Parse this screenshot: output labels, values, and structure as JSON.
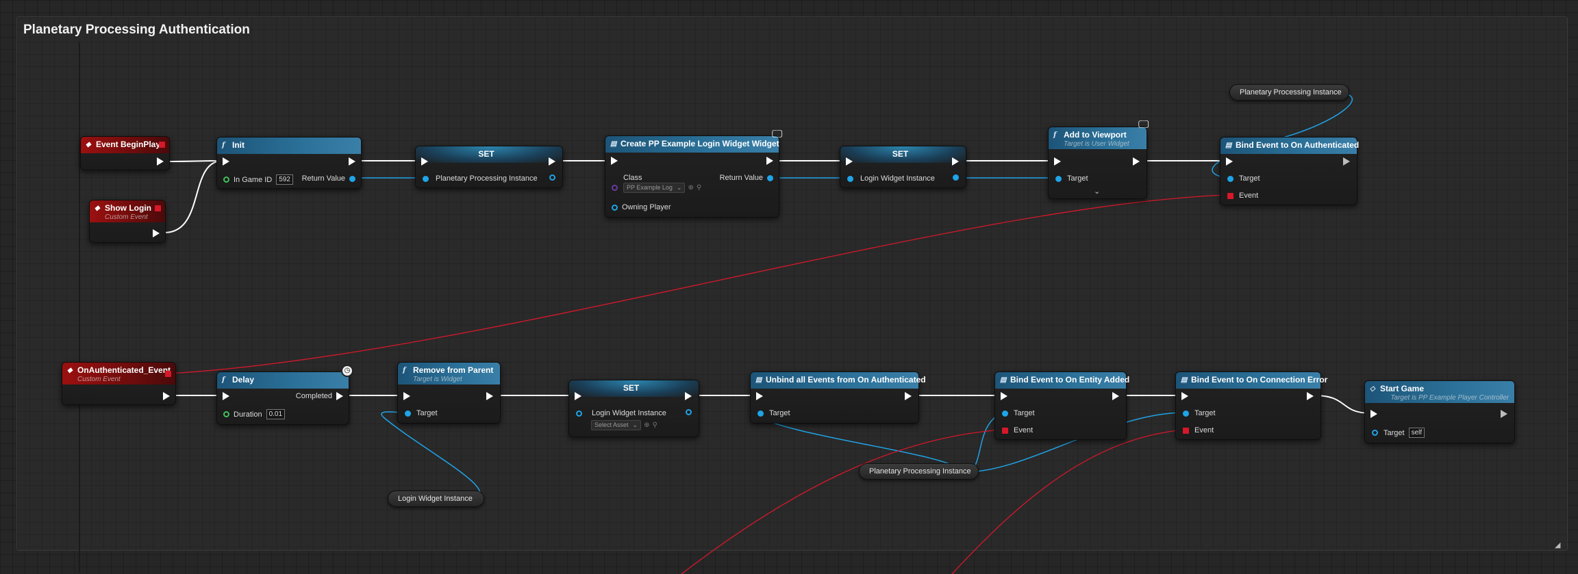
{
  "comment": {
    "title": "Planetary Processing Authentication"
  },
  "nodes": {
    "event_beginplay": {
      "title": "Event BeginPlay"
    },
    "show_login": {
      "title": "Show Login",
      "subtitle": "Custom Event"
    },
    "init": {
      "title": "Init",
      "in_game_id_label": "In Game ID",
      "in_game_id_value": "592",
      "return_label": "Return Value"
    },
    "set1": {
      "title": "SET",
      "var_label": "Planetary Processing Instance"
    },
    "create_widget": {
      "title": "Create PP Example Login Widget Widget",
      "class_label": "Class",
      "class_value": "PP Example Log",
      "return_label": "Return Value",
      "owning_label": "Owning Player"
    },
    "set2": {
      "title": "SET",
      "var_label": "Login Widget Instance"
    },
    "add_viewport": {
      "title": "Add to Viewport",
      "subtitle": "Target is User Widget",
      "target_label": "Target"
    },
    "bind_auth": {
      "title": "Bind Event to On Authenticated",
      "target_label": "Target",
      "event_label": "Event"
    },
    "onauth_event": {
      "title": "OnAuthenticated_Event",
      "subtitle": "Custom Event"
    },
    "delay": {
      "title": "Delay",
      "completed_label": "Completed",
      "duration_label": "Duration",
      "duration_value": "0.01"
    },
    "remove_parent": {
      "title": "Remove from Parent",
      "subtitle": "Target is Widget",
      "target_label": "Target"
    },
    "set3": {
      "title": "SET",
      "var_label": "Login Widget Instance",
      "select_value": "Select Asset"
    },
    "unbind": {
      "title": "Unbind all Events from On Authenticated",
      "target_label": "Target"
    },
    "bind_entity": {
      "title": "Bind Event to On Entity Added",
      "target_label": "Target",
      "event_label": "Event"
    },
    "bind_conn": {
      "title": "Bind Event to On Connection Error",
      "target_label": "Target",
      "event_label": "Event"
    },
    "start_game": {
      "title": "Start Game",
      "subtitle": "Target is PP Example Player Controller",
      "target_label": "Target",
      "target_value": "self"
    }
  },
  "getters": {
    "pp_top": "Planetary Processing Instance",
    "login_widget": "Login Widget Instance",
    "pp_bottom": "Planetary Processing Instance"
  },
  "icons": {
    "event": "event-diamond-icon",
    "function": "function-f-icon",
    "latent": "clock-icon",
    "widget": "monitor-icon",
    "resize": "resize-grip-icon"
  },
  "colors": {
    "exec_wire": "#ffffff",
    "object_wire": "#1fa4e8",
    "delegate_wire": "#d6182a",
    "function_header": "#2b7199",
    "event_header": "#9b1010"
  }
}
